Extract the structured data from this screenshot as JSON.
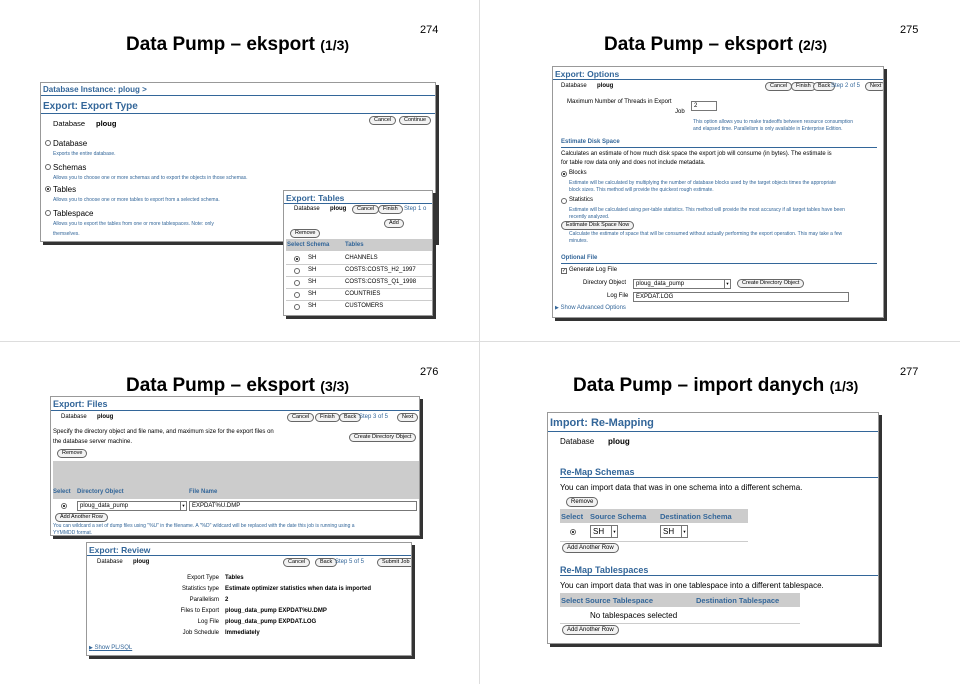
{
  "slides": [
    {
      "number": "274",
      "title_main": "Data Pump – eksport",
      "title_sub": "(1/3)",
      "breadcrumb": "Database Instance: ploug >",
      "header": "Export: Export Type",
      "database_label": "Database",
      "database_value": "ploug",
      "cancel": "Cancel",
      "continue": "Continue",
      "options": [
        {
          "label": "Database",
          "desc": "Exports the entire database."
        },
        {
          "label": "Schemas",
          "desc": "Allows you to choose one or more schemas and to export the objects in those schemas."
        },
        {
          "label": "Tables",
          "desc": "Allows you to choose one or more tables to export from a selected schema."
        },
        {
          "label": "Tablespace",
          "desc": "Allows you to export the tables from one or more tablespaces. Note: only"
        }
      ],
      "desc_tail": "themselves.",
      "popup": {
        "header": "Export: Tables",
        "database_label": "Database",
        "database_value": "ploug",
        "cancel": "Cancel",
        "finish": "Finish",
        "step": "Step 1 o",
        "add": "Add",
        "remove": "Remove",
        "col_schema": "Select Schema",
        "col_tables": "Tables",
        "rows": [
          {
            "schema": "SH",
            "table": "CHANNELS"
          },
          {
            "schema": "SH",
            "table": "COSTS:COSTS_H2_1997"
          },
          {
            "schema": "SH",
            "table": "COSTS:COSTS_Q1_1998"
          },
          {
            "schema": "SH",
            "table": "COUNTRIES"
          },
          {
            "schema": "SH",
            "table": "CUSTOMERS"
          }
        ]
      }
    },
    {
      "number": "275",
      "title_main": "Data Pump – eksport",
      "title_sub": "(2/3)",
      "header": "Export: Options",
      "database_label": "Database",
      "database_value": "ploug",
      "cancel": "Cancel",
      "finish": "Finish",
      "back": "Back",
      "step": "Step 2 of 5",
      "next": "Next",
      "threads_label_1": "Maximum Number of Threads in Export",
      "threads_label_2": "Job",
      "threads_value": "2",
      "threads_note_1": "This option allows you to make tradeoffs between resource consumption",
      "threads_note_2": "and elapsed time. Parallelism is only available in Enterprise Edition.",
      "estimate_header": "Estimate Disk Space",
      "estimate_desc_1": "Calculates an estimate of how much disk space the export job will consume (in bytes). The estimate is",
      "estimate_desc_2": "for table row data only and does not include metadata.",
      "blocks_label": "Blocks",
      "blocks_desc_1": "Estimate will be calculated by multiplying the number of database blocks used by the target objects times the appropriate",
      "blocks_desc_2": "block sizes. This method will provide the quickest rough estimate.",
      "stats_label": "Statistics",
      "stats_desc_1": "Estimate will be calculated using per-table statistics. This method will provide the most accuracy if all target tables have been",
      "stats_desc_2": "recently analyzed.",
      "estimate_btn": "Estimate Disk Space Now",
      "estimate_note_1": "Calculate the estimate of space that will be consumed without actually performing the export operation. This may take a few",
      "estimate_note_2": "minutes.",
      "optional_header": "Optional File",
      "gen_log": "Generate Log File",
      "dir_label": "Directory Object",
      "dir_value": "ploug_data_pump",
      "create_dir": "Create Directory Object",
      "logfile_label": "Log File",
      "logfile_value": "EXPDAT.LOG",
      "advanced": "Show Advanced Options"
    },
    {
      "number": "276",
      "title_main": "Data Pump – eksport",
      "title_sub": "(3/3)",
      "header": "Export: Files",
      "database_label": "Database",
      "database_value": "ploug",
      "cancel": "Cancel",
      "finish": "Finish",
      "back": "Back",
      "step": "Step 3 of 5",
      "next": "Next",
      "desc_1": "Specify the directory object and file name, and maximum size for the export files on",
      "desc_2": "the database server machine.",
      "create_dir": "Create Directory Object",
      "remove": "Remove",
      "col_select": "Select",
      "col_dir": "Directory Object",
      "col_file": "File Name",
      "dir_value": "ploug_data_pump",
      "file_value": "EXPDAT%U.DMP",
      "add_row": "Add Another Row",
      "note_1": "You can wildcard a set of dump files using \"%U\" in the filename. A \"%D\" wildcard will be replaced with the date this job is running using a",
      "note_2": "YYMMDD format.",
      "review": {
        "header": "Export: Review",
        "database_label": "Database",
        "database_value": "ploug",
        "cancel": "Cancel",
        "back": "Back",
        "step": "Step 5 of 5",
        "submit": "Submit Job",
        "rows": [
          {
            "label": "Export Type",
            "value": "Tables"
          },
          {
            "label": "Statistics type",
            "value": "Estimate optimizer statistics when data is imported"
          },
          {
            "label": "Parallelism",
            "value": "2"
          },
          {
            "label": "Files to Export",
            "value": "ploug_data_pump EXPDAT%U.DMP"
          },
          {
            "label": "Log File",
            "value": "ploug_data_pump EXPDAT.LOG"
          },
          {
            "label": "Job Schedule",
            "value": "Immediately"
          }
        ],
        "show_sql": "Show PL/SQL"
      }
    },
    {
      "number": "277",
      "title_main": "Data Pump – import danych",
      "title_sub": "(1/3)",
      "header": "Import: Re-Mapping",
      "database_label": "Database",
      "database_value": "ploug",
      "schemas_header": "Re-Map Schemas",
      "schemas_desc": "You can import data that was in one schema into a different schema.",
      "remove": "Remove",
      "col_select": "Select",
      "col_src_schema": "Source Schema",
      "col_dst_schema": "Destination Schema",
      "src_value": "SH",
      "dst_value": "SH",
      "add_row": "Add Another Row",
      "tbs_header": "Re-Map Tablespaces",
      "tbs_desc": "You can import data that was in one tablespace into a different tablespace.",
      "col_src_tbs": "Select Source Tablespace",
      "col_dst_tbs": "Destination Tablespace",
      "no_tbs": "No tablespaces selected",
      "add_row_2": "Add Another Row"
    }
  ]
}
